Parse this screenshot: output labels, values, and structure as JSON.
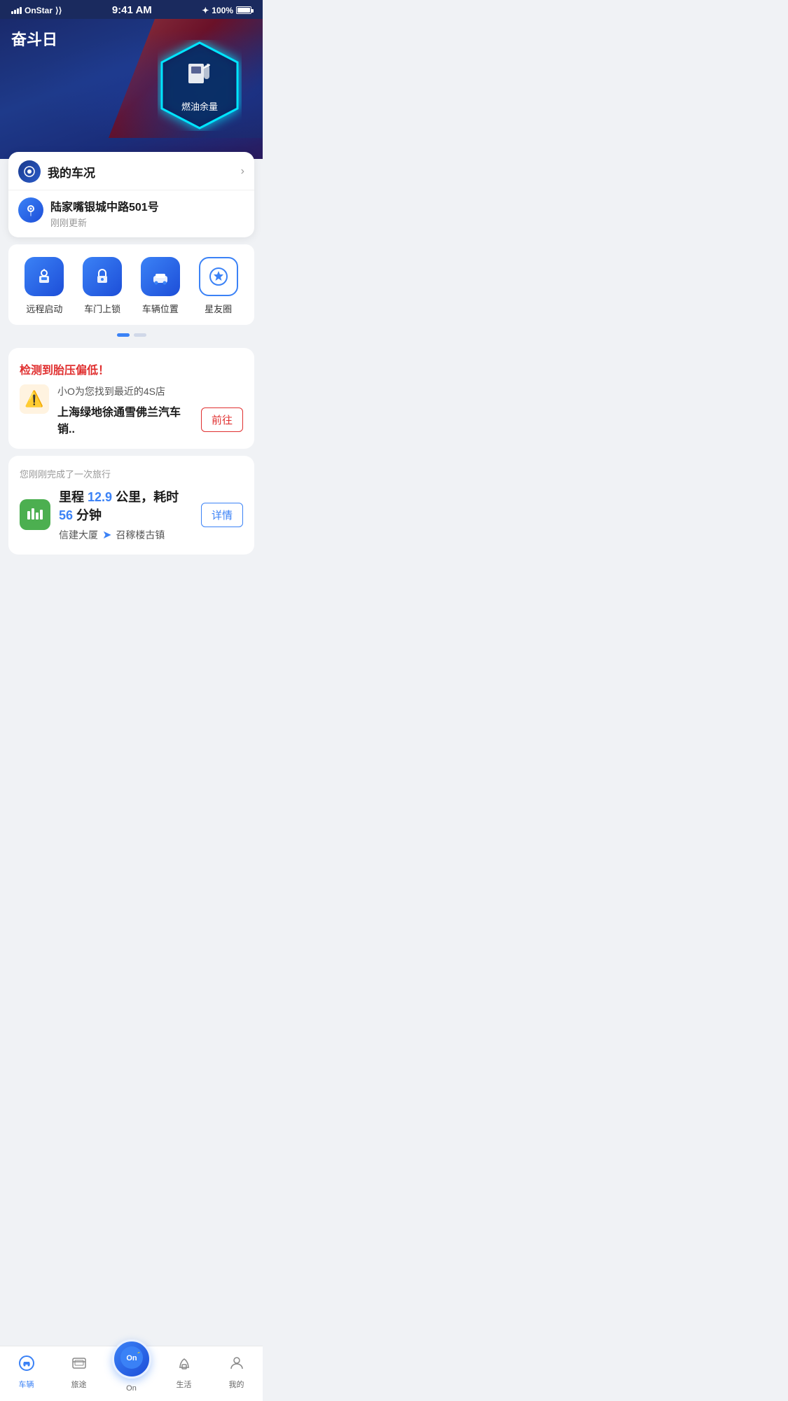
{
  "statusBar": {
    "carrier": "OnStar",
    "time": "9:41 AM",
    "battery": "100%"
  },
  "hero": {
    "title": "奋斗日",
    "hexBadge": {
      "label": "燃油余量"
    }
  },
  "myCarStatus": {
    "label": "我的车况",
    "locationAddress": "陆家嘴银城中路501号",
    "locationTime": "刚刚更新"
  },
  "quickActions": [
    {
      "id": "remote-start",
      "label": "远程启动"
    },
    {
      "id": "door-lock",
      "label": "车门上锁"
    },
    {
      "id": "car-location",
      "label": "车辆位置"
    },
    {
      "id": "star-circle",
      "label": "星友圈"
    }
  ],
  "tirePressureCard": {
    "alertTitle": "检测到胎压偏低！",
    "subtitle": "小O为您找到最近的4S店",
    "shopName": "上海绿地徐通雪佛兰汽车销..",
    "gotoLabel": "前往"
  },
  "tripCard": {
    "completedLabel": "您刚刚完成了一次旅行",
    "distanceLabel": "里程",
    "distance": "12.9",
    "distanceUnit": "公里，耗时",
    "duration": "56",
    "durationUnit": "分钟",
    "from": "信建大厦",
    "to": "召稼楼古镇",
    "detailsLabel": "详情"
  },
  "bottomNav": [
    {
      "id": "vehicle",
      "label": "车辆",
      "active": true
    },
    {
      "id": "trip",
      "label": "旅途",
      "active": false
    },
    {
      "id": "center",
      "label": "On",
      "active": false,
      "isCenter": true
    },
    {
      "id": "life",
      "label": "生活",
      "active": false
    },
    {
      "id": "mine",
      "label": "我的",
      "active": false
    }
  ]
}
